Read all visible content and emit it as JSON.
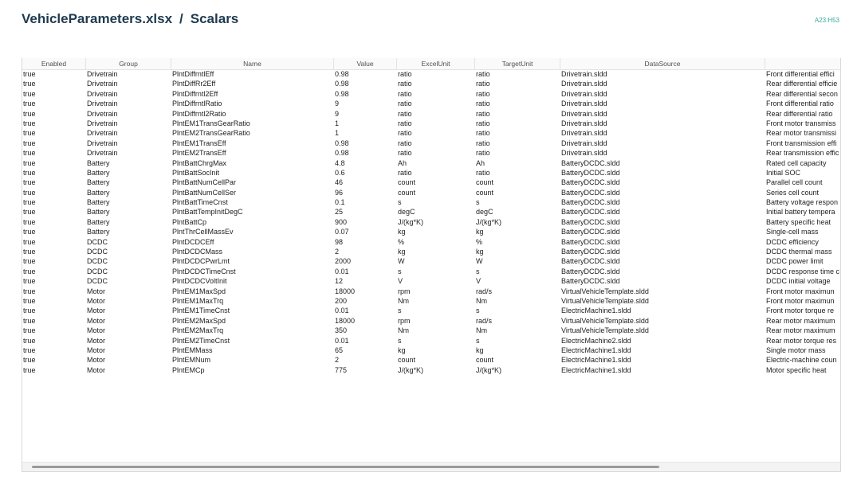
{
  "header": {
    "file": "VehicleParameters.xlsx",
    "separator": "/",
    "sheet": "Scalars",
    "range": "A23:H53"
  },
  "table": {
    "columns": [
      "Enabled",
      "Group",
      "Name",
      "Value",
      "ExcelUnit",
      "TargetUnit",
      "DataSource",
      ""
    ],
    "rows": [
      [
        "true",
        "Drivetrain",
        "PlntDiffrntlEff",
        "0.98",
        "ratio",
        "ratio",
        "Drivetrain.sldd",
        "Front differential effici"
      ],
      [
        "true",
        "Drivetrain",
        "PlntDiffRr2Eff",
        "0.98",
        "ratio",
        "ratio",
        "Drivetrain.sldd",
        "Rear differential efficie"
      ],
      [
        "true",
        "Drivetrain",
        "PlntDiffrntl2Eff",
        "0.98",
        "ratio",
        "ratio",
        "Drivetrain.sldd",
        "Rear differential secon"
      ],
      [
        "true",
        "Drivetrain",
        "PlntDiffrntlRatio",
        "9",
        "ratio",
        "ratio",
        "Drivetrain.sldd",
        "Front differential ratio"
      ],
      [
        "true",
        "Drivetrain",
        "PlntDiffrntl2Ratio",
        "9",
        "ratio",
        "ratio",
        "Drivetrain.sldd",
        "Rear differential ratio"
      ],
      [
        "true",
        "Drivetrain",
        "PlntEM1TransGearRatio",
        "1",
        "ratio",
        "ratio",
        "Drivetrain.sldd",
        "Front motor transmiss"
      ],
      [
        "true",
        "Drivetrain",
        "PlntEM2TransGearRatio",
        "1",
        "ratio",
        "ratio",
        "Drivetrain.sldd",
        "Rear motor transmissi"
      ],
      [
        "true",
        "Drivetrain",
        "PlntEM1TransEff",
        "0.98",
        "ratio",
        "ratio",
        "Drivetrain.sldd",
        "Front transmission effi"
      ],
      [
        "true",
        "Drivetrain",
        "PlntEM2TransEff",
        "0.98",
        "ratio",
        "ratio",
        "Drivetrain.sldd",
        "Rear transmission effic"
      ],
      [
        "true",
        "Battery",
        "PlntBattChrgMax",
        "4.8",
        "Ah",
        "Ah",
        "BatteryDCDC.sldd",
        "Rated cell capacity"
      ],
      [
        "true",
        "Battery",
        "PlntBattSocInit",
        "0.6",
        "ratio",
        "ratio",
        "BatteryDCDC.sldd",
        "Initial SOC"
      ],
      [
        "true",
        "Battery",
        "PlntBattNumCellPar",
        "46",
        "count",
        "count",
        "BatteryDCDC.sldd",
        "Parallel cell count"
      ],
      [
        "true",
        "Battery",
        "PlntBattNumCellSer",
        "96",
        "count",
        "count",
        "BatteryDCDC.sldd",
        "Series cell count"
      ],
      [
        "true",
        "Battery",
        "PlntBattTimeCnst",
        "0.1",
        "s",
        "s",
        "BatteryDCDC.sldd",
        "Battery voltage respon"
      ],
      [
        "true",
        "Battery",
        "PlntBattTempInitDegC",
        "25",
        "degC",
        "degC",
        "BatteryDCDC.sldd",
        "Initial battery tempera"
      ],
      [
        "true",
        "Battery",
        "PlntBattCp",
        "900",
        "J/(kg*K)",
        "J/(kg*K)",
        "BatteryDCDC.sldd",
        "Battery specific heat"
      ],
      [
        "true",
        "Battery",
        "PlntThrCellMassEv",
        "0.07",
        "kg",
        "kg",
        "BatteryDCDC.sldd",
        "Single-cell mass"
      ],
      [
        "true",
        "DCDC",
        "PlntDCDCEff",
        "98",
        "%",
        "%",
        "BatteryDCDC.sldd",
        "DCDC efficiency"
      ],
      [
        "true",
        "DCDC",
        "PlntDCDCMass",
        "2",
        "kg",
        "kg",
        "BatteryDCDC.sldd",
        "DCDC thermal mass"
      ],
      [
        "true",
        "DCDC",
        "PlntDCDCPwrLmt",
        "2000",
        "W",
        "W",
        "BatteryDCDC.sldd",
        "DCDC power limit"
      ],
      [
        "true",
        "DCDC",
        "PlntDCDCTimeCnst",
        "0.01",
        "s",
        "s",
        "BatteryDCDC.sldd",
        "DCDC response time c"
      ],
      [
        "true",
        "DCDC",
        "PlntDCDCVoltInit",
        "12",
        "V",
        "V",
        "BatteryDCDC.sldd",
        "DCDC initial voltage"
      ],
      [
        "true",
        "Motor",
        "PlntEM1MaxSpd",
        "18000",
        "rpm",
        "rad/s",
        "VirtualVehicleTemplate.sldd",
        "Front motor maximun"
      ],
      [
        "true",
        "Motor",
        "PlntEM1MaxTrq",
        "200",
        "Nm",
        "Nm",
        "VirtualVehicleTemplate.sldd",
        "Front motor maximun"
      ],
      [
        "true",
        "Motor",
        "PlntEM1TimeCnst",
        "0.01",
        "s",
        "s",
        "ElectricMachine1.sldd",
        "Front motor torque re"
      ],
      [
        "true",
        "Motor",
        "PlntEM2MaxSpd",
        "18000",
        "rpm",
        "rad/s",
        "VirtualVehicleTemplate.sldd",
        "Rear motor maximum"
      ],
      [
        "true",
        "Motor",
        "PlntEM2MaxTrq",
        "350",
        "Nm",
        "Nm",
        "VirtualVehicleTemplate.sldd",
        "Rear motor maximum"
      ],
      [
        "true",
        "Motor",
        "PlntEM2TimeCnst",
        "0.01",
        "s",
        "s",
        "ElectricMachine2.sldd",
        "Rear motor torque res"
      ],
      [
        "true",
        "Motor",
        "PlntEMMass",
        "65",
        "kg",
        "kg",
        "ElectricMachine1.sldd",
        "Single motor mass"
      ],
      [
        "true",
        "Motor",
        "PlntEMNum",
        "2",
        "count",
        "count",
        "ElectricMachine1.sldd",
        "Electric-machine coun"
      ],
      [
        "true",
        "Motor",
        "PlntEMCp",
        "775",
        "J/(kg*K)",
        "J/(kg*K)",
        "ElectricMachine1.sldd",
        "Motor specific heat"
      ]
    ]
  }
}
